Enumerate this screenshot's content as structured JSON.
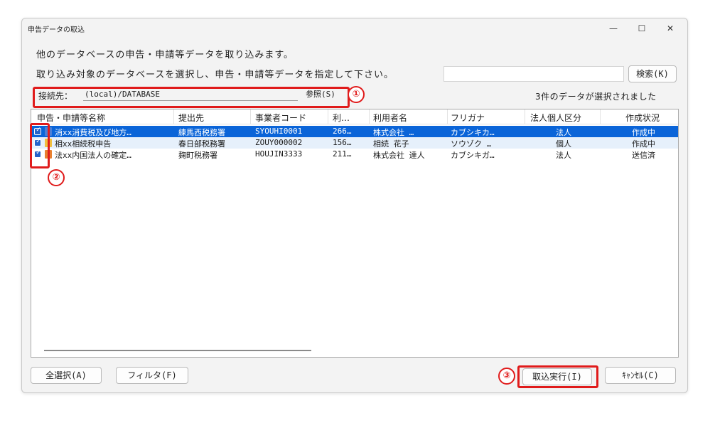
{
  "window": {
    "title": "申告データの取込",
    "minimize_glyph": "—",
    "maximize_glyph": "☐",
    "close_glyph": "✕"
  },
  "messages": {
    "line1": "他のデータベースの申告・申請等データを取り込みます。",
    "line2": "取り込み対象のデータベースを選択し、申告・申請等データを指定して下さい。"
  },
  "search": {
    "value": "",
    "button_label": "検索(K)"
  },
  "connection": {
    "label": "接続先：",
    "value": "(local)/DATABASE",
    "browse_label": "参照(S)"
  },
  "status": "3件のデータが選択されました",
  "table": {
    "columns": [
      "申告・申請等名称",
      "提出先",
      "事業者コード",
      "利…",
      "利用者名",
      "フリガナ",
      "法人個人区分",
      "作成状況"
    ],
    "rows": [
      {
        "checked": true,
        "selected": true,
        "icon_color": "#4a7fd6",
        "cells": [
          "消xx消費税及び地方…",
          "練馬西税務署",
          "SYOUHI0001",
          "266…",
          "株式会社 …",
          "カブシキカ…",
          "法人",
          "作成中"
        ]
      },
      {
        "checked": true,
        "selected": false,
        "icon_color": "#f0c040",
        "cells": [
          "相xx相続税申告",
          "春日部税務署",
          "ZOUY000002",
          "156…",
          "相続 花子",
          "ソウゾク …",
          "個人",
          "作成中"
        ]
      },
      {
        "checked": true,
        "selected": false,
        "icon_color": "#e88030",
        "cells": [
          "法xx内国法人の確定…",
          "麹町税務署",
          "HOUJIN3333",
          "211…",
          "株式会社 達人",
          "カブシキガ…",
          "法人",
          "送信済"
        ]
      }
    ]
  },
  "buttons": {
    "select_all": "全選択(A)",
    "filter": "フィルタ(F)",
    "execute": "取込実行(I)",
    "cancel": "ｷｬﾝｾﾙ(C)"
  },
  "markers": [
    "①",
    "②",
    "③"
  ],
  "colors": {
    "accent_red": "#e01b1b",
    "selection": "#0a64d8",
    "row_hover": "#e6f0fb"
  }
}
